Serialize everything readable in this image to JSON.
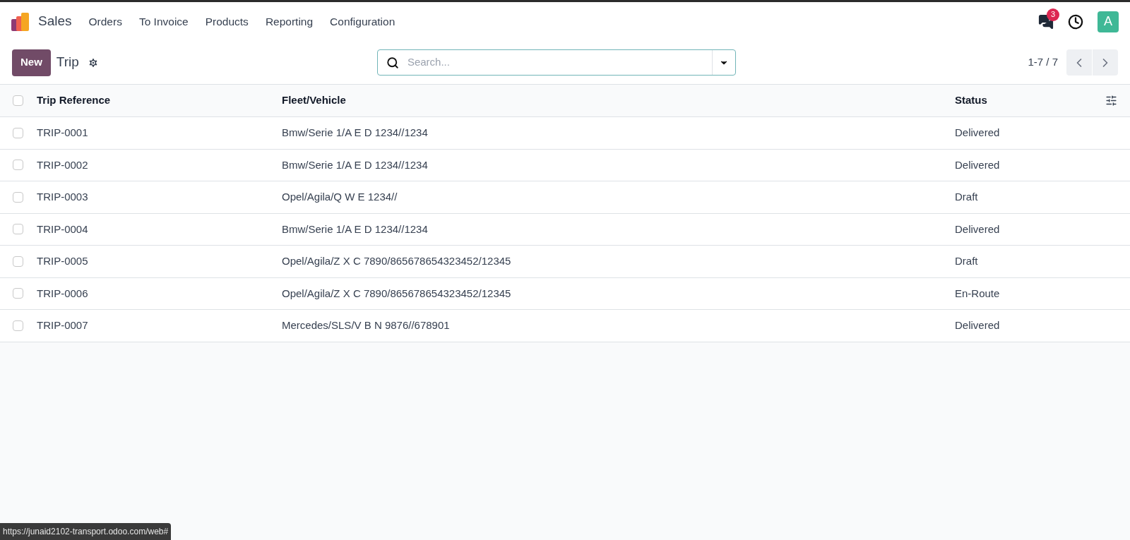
{
  "navbar": {
    "app_name": "Sales",
    "menu": [
      "Orders",
      "To Invoice",
      "Products",
      "Reporting",
      "Configuration"
    ],
    "messages_badge": "3",
    "avatar": "A"
  },
  "control_panel": {
    "new_button": "New",
    "title": "Trip",
    "search": {
      "placeholder": "Search..."
    },
    "pager": "1-7 / 7"
  },
  "table": {
    "select_all_checked": false,
    "columns": [
      "Trip Reference",
      "Fleet/Vehicle",
      "Status"
    ],
    "rows": [
      {
        "reference": "TRIP-0001",
        "vehicle": "Bmw/Serie 1/A E D 1234//1234",
        "status": "Delivered",
        "checked": false
      },
      {
        "reference": "TRIP-0002",
        "vehicle": "Bmw/Serie 1/A E D 1234//1234",
        "status": "Delivered",
        "checked": false
      },
      {
        "reference": "TRIP-0003",
        "vehicle": "Opel/Agila/Q W E 1234//",
        "status": "Draft",
        "checked": false
      },
      {
        "reference": "TRIP-0004",
        "vehicle": "Bmw/Serie 1/A E D 1234//1234",
        "status": "Delivered",
        "checked": false
      },
      {
        "reference": "TRIP-0005",
        "vehicle": "Opel/Agila/Z X C 7890/865678654323452/12345",
        "status": "Draft",
        "checked": false
      },
      {
        "reference": "TRIP-0006",
        "vehicle": "Opel/Agila/Z X C 7890/865678654323452/12345",
        "status": "En-Route",
        "checked": false
      },
      {
        "reference": "TRIP-0007",
        "vehicle": "Mercedes/SLS/V B N 9876//678901",
        "status": "Delivered",
        "checked": false
      }
    ]
  },
  "status_url": "https://junaid2102-transport.odoo.com/web#"
}
